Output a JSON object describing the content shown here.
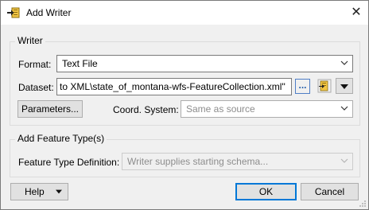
{
  "window": {
    "title": "Add Writer",
    "icon": "add-writer-icon",
    "close_icon": "close-icon"
  },
  "writer_group": {
    "label": "Writer",
    "format_label": "Format:",
    "format_value": "Text File",
    "dataset_label": "Dataset:",
    "dataset_value": "to XML\\state_of_montana-wfs-FeatureCollection.xml\"",
    "browse_label": "...",
    "parameters_label": "Parameters...",
    "coord_label": "Coord. System:",
    "coord_value": "Same as source"
  },
  "feature_group": {
    "label": "Add Feature Type(s)",
    "definition_label": "Feature Type Definition:",
    "definition_value": "Writer supplies starting schema..."
  },
  "footer": {
    "help_label": "Help",
    "ok_label": "OK",
    "cancel_label": "Cancel"
  },
  "colors": {
    "accent": "#0078d7",
    "border": "#7a7a7a",
    "disabled_text": "#8d8d8d"
  }
}
